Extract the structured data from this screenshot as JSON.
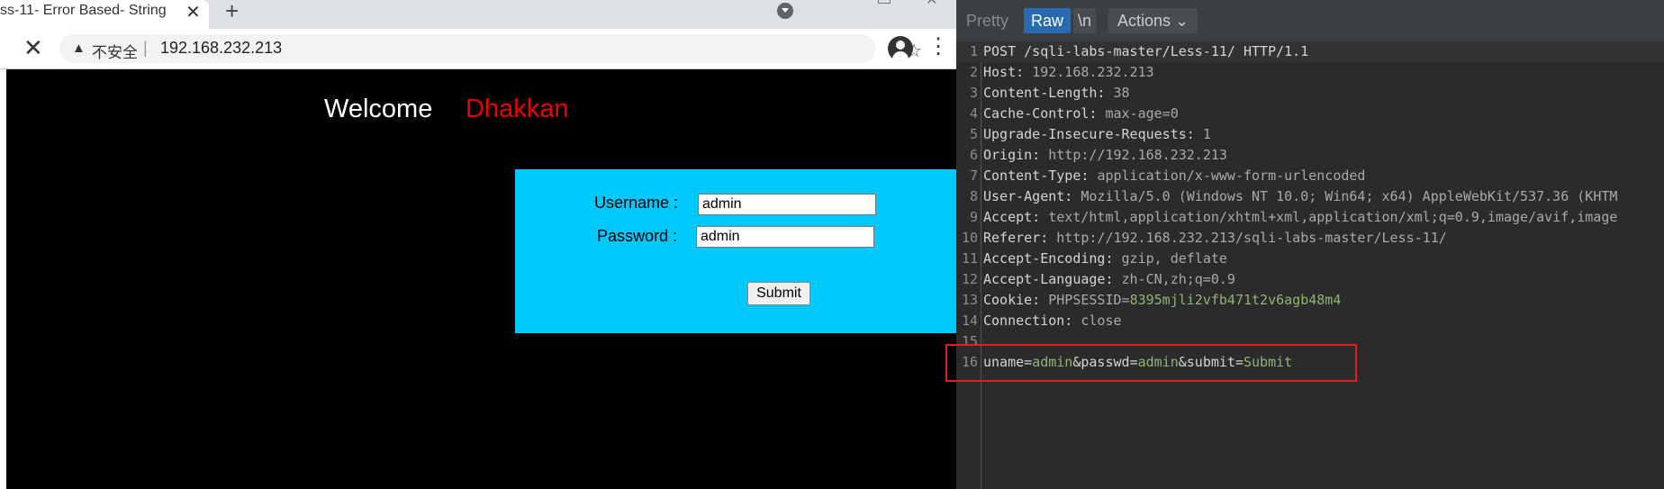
{
  "browser": {
    "tab_title": "ss-11- Error Based- String",
    "tab_close": "✕",
    "new_tab": "+",
    "stop": "✕",
    "not_secure": "不安全",
    "separator": "|",
    "url": "192.168.232.213",
    "star": "☆",
    "menu": "⋮"
  },
  "page": {
    "welcome": "Welcome",
    "name": "Dhakkan",
    "username_label": "Username :",
    "password_label": "Password :",
    "username_value": "admin",
    "password_value": "admin",
    "submit_label": "Submit",
    "colors": {
      "background": "#000000",
      "panel": "#00c8fa",
      "name": "#ee0000"
    }
  },
  "burp": {
    "tabs": {
      "pretty": "Pretty",
      "raw": "Raw",
      "newline": "\\n",
      "actions": "Actions ⌄"
    },
    "lines": [
      {
        "num": "1",
        "key": "POST /sqli-labs-master/Less-11/ HTTP/1.1",
        "val": ""
      },
      {
        "num": "2",
        "key": "Host: ",
        "val": "192.168.232.213"
      },
      {
        "num": "3",
        "key": "Content-Length: ",
        "val": "38"
      },
      {
        "num": "4",
        "key": "Cache-Control: ",
        "val": "max-age=0"
      },
      {
        "num": "5",
        "key": "Upgrade-Insecure-Requests: ",
        "val": "1"
      },
      {
        "num": "6",
        "key": "Origin: ",
        "val": "http://192.168.232.213"
      },
      {
        "num": "7",
        "key": "Content-Type: ",
        "val": "application/x-www-form-urlencoded"
      },
      {
        "num": "8",
        "key": "User-Agent: ",
        "val": "Mozilla/5.0 (Windows NT 10.0; Win64; x64) AppleWebKit/537.36 (KHTM"
      },
      {
        "num": "9",
        "key": "Accept: ",
        "val": "text/html,application/xhtml+xml,application/xml;q=0.9,image/avif,image"
      },
      {
        "num": "10",
        "key": "Referer: ",
        "val": "http://192.168.232.213/sqli-labs-master/Less-11/"
      },
      {
        "num": "11",
        "key": "Accept-Encoding: ",
        "val": "gzip, deflate"
      },
      {
        "num": "12",
        "key": "Accept-Language: ",
        "val": "zh-CN,zh;q=0.9"
      },
      {
        "num": "13",
        "key": "Cookie: ",
        "val": "PHPSESSID=",
        "val2": "8395mjli2vfb471t2v6agb48m4"
      },
      {
        "num": "14",
        "key": "Connection: ",
        "val": "close"
      },
      {
        "num": "15",
        "key": "",
        "val": ""
      }
    ],
    "body_line": {
      "num": "16",
      "parts": [
        "uname",
        "=",
        "admin",
        "&passwd",
        "=",
        "admin",
        "&submit",
        "=",
        "Submit"
      ]
    },
    "colors": {
      "raw_tab": "#2a6ab1",
      "highlight_box": "#e02020",
      "param_value": "#8fb573"
    }
  }
}
